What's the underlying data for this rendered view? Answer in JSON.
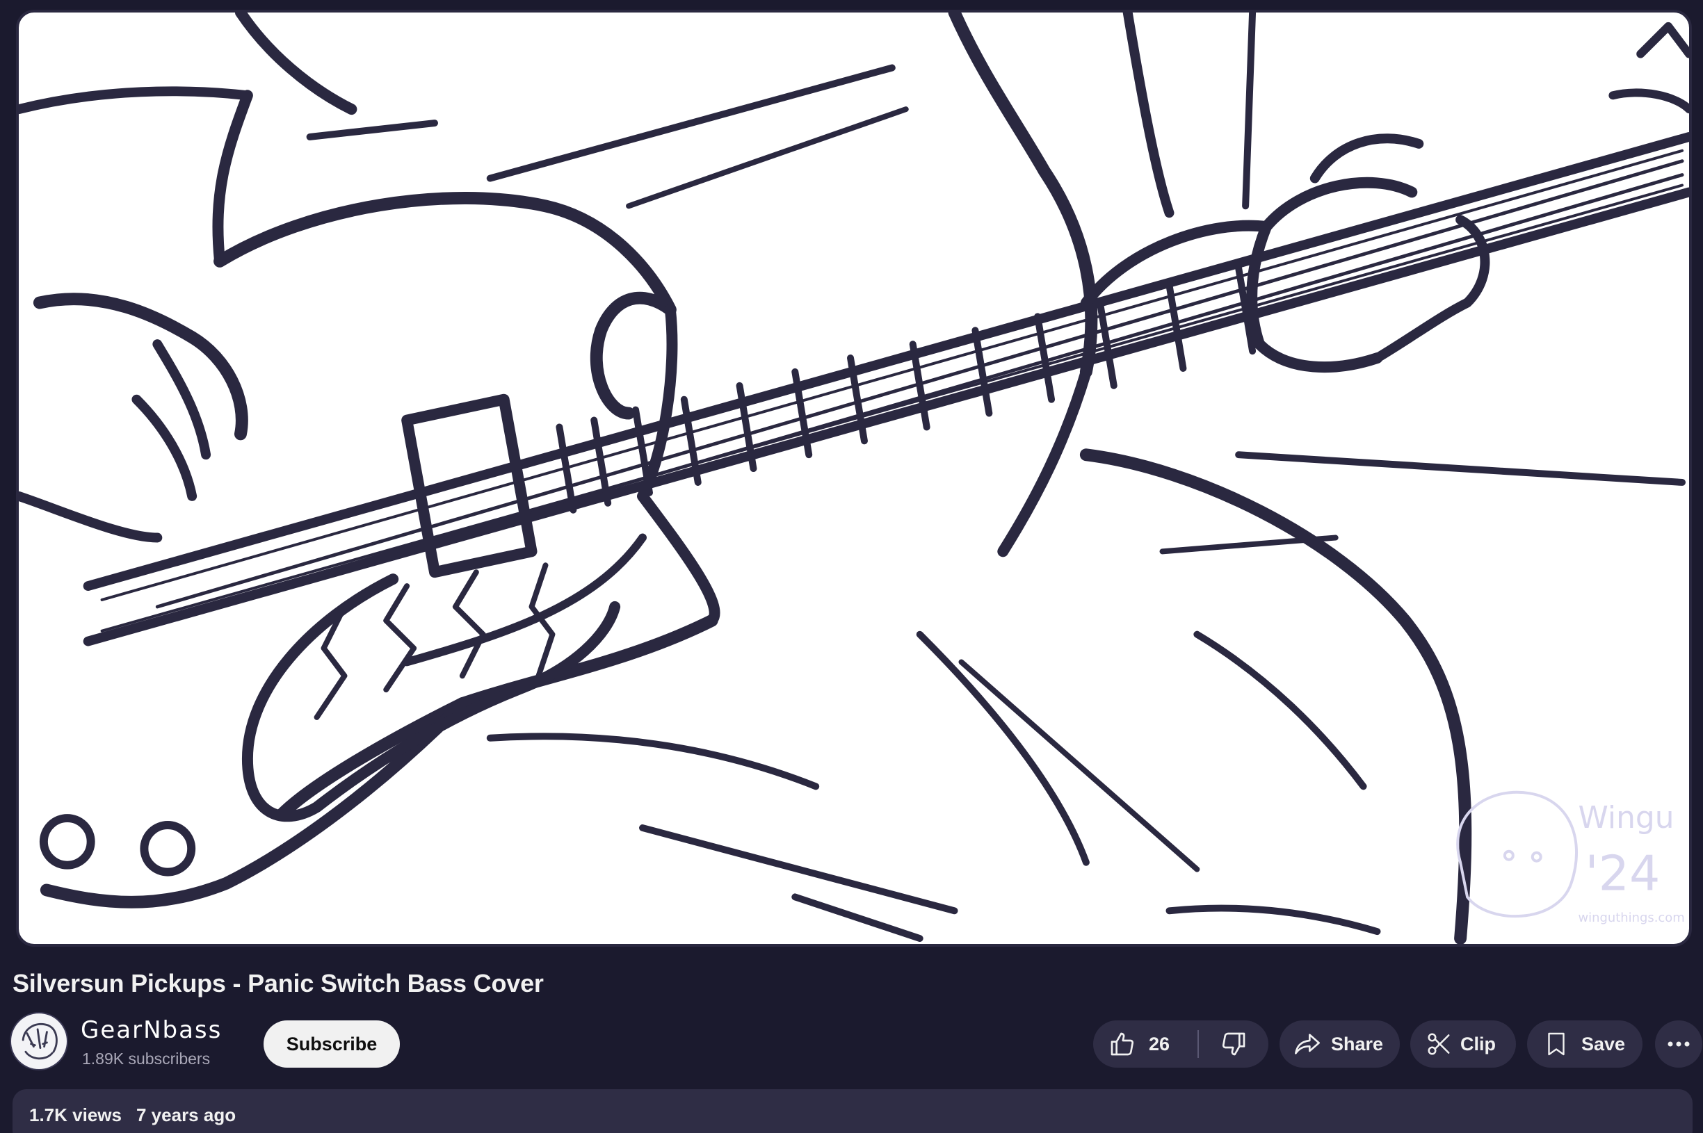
{
  "video": {
    "title": "Silversun Pickups - Panic Switch Bass Cover",
    "thumbnail_description": "ink drawing of hands playing a bass guitar",
    "watermark": {
      "name": "Wingu",
      "year": "'24",
      "site": "winguthings.com"
    }
  },
  "channel": {
    "name": "GearNbass",
    "subscribers": "1.89K subscribers",
    "subscribe_label": "Subscribe"
  },
  "actions": {
    "like_count": "26",
    "share_label": "Share",
    "clip_label": "Clip",
    "save_label": "Save"
  },
  "description": {
    "views": "1.7K views",
    "age": "7 years ago"
  },
  "icons": {
    "like": "thumbs-up-icon",
    "dislike": "thumbs-down-icon",
    "share": "share-arrow-icon",
    "clip": "scissors-icon",
    "save": "bookmark-icon",
    "more": "more-horizontal-icon"
  },
  "colors": {
    "background": "#1b1a2e",
    "pill": "#2f2d45",
    "ink": "#2a2840",
    "watermark": "#d8d6ee"
  }
}
